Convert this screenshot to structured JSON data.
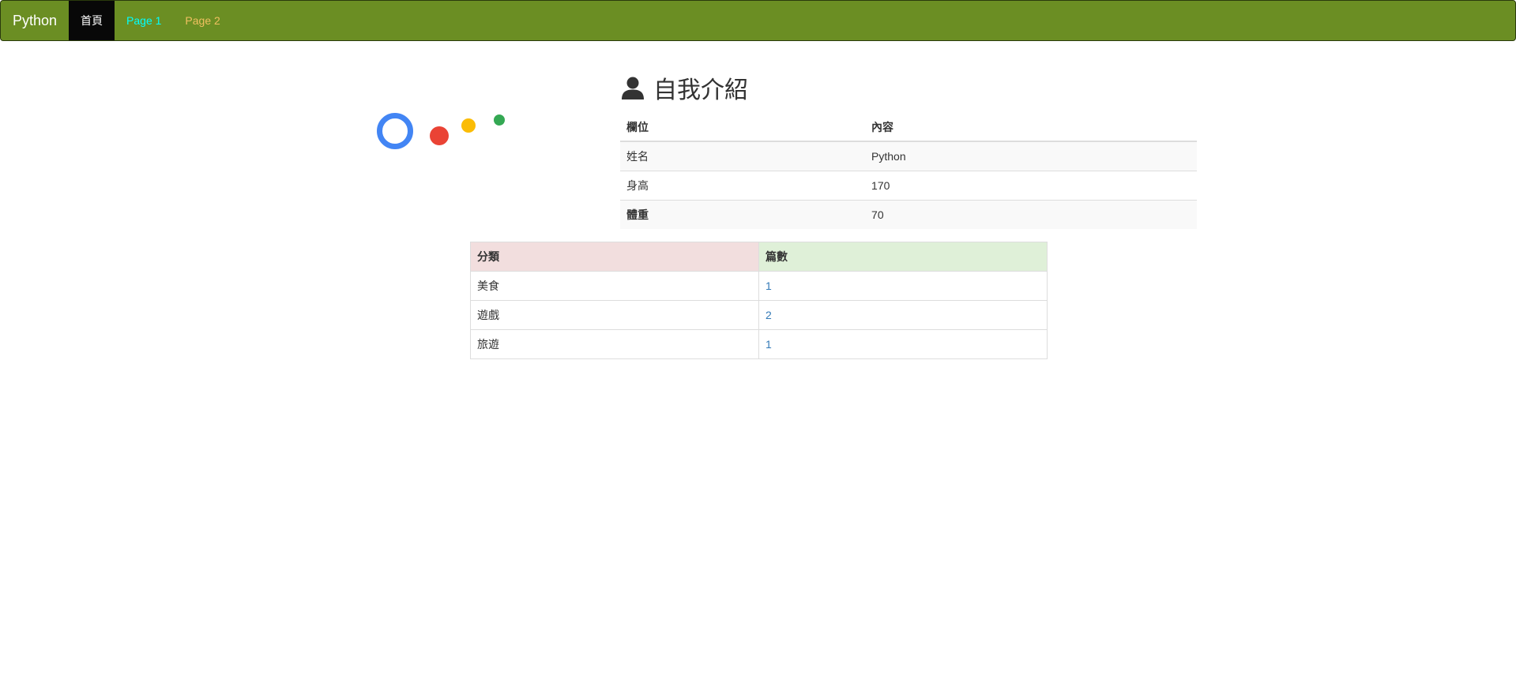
{
  "navbar": {
    "brand": "Python",
    "items": [
      {
        "label": "首頁",
        "active": true
      },
      {
        "label": "Page 1",
        "color": "#00ffff"
      },
      {
        "label": "Page 2",
        "color": "#f0c060"
      }
    ],
    "background": "#6b8e23"
  },
  "logo": {
    "colors": [
      "#4285f4",
      "#ea4335",
      "#fbbc05",
      "#34a853"
    ]
  },
  "intro": {
    "icon": "user-icon",
    "title": "自我介紹",
    "headers": [
      "欄位",
      "內容"
    ],
    "rows": [
      [
        "姓名",
        "Python"
      ],
      [
        "身高",
        "170"
      ],
      [
        "體重",
        "70"
      ]
    ]
  },
  "categories": {
    "headers": [
      "分類",
      "篇數"
    ],
    "rows": [
      [
        "美食",
        "1"
      ],
      [
        "遊戲",
        "2"
      ],
      [
        "旅遊",
        "1"
      ]
    ],
    "header_colors": [
      "#f2dede",
      "#dff0d8"
    ],
    "link_color": "#337ab7"
  }
}
